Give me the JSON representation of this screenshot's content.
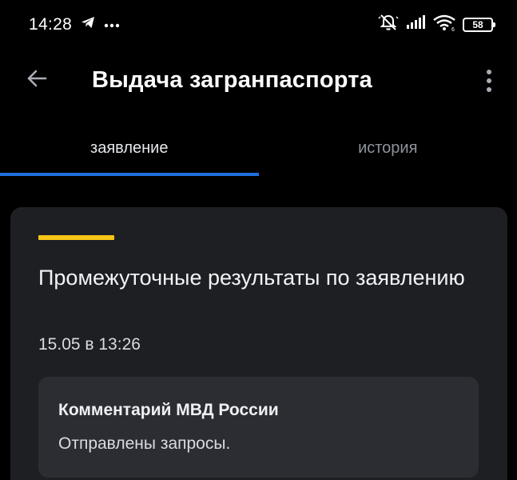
{
  "status_bar": {
    "time": "14:28",
    "left_icons": [
      "telegram-icon",
      "more-notifications-icon"
    ],
    "right_icons": [
      "alarm-off-icon",
      "signal-icon",
      "wifi-icon"
    ],
    "battery": "58"
  },
  "app_bar": {
    "title": "Выдача загранпаспорта",
    "back_icon": "arrow-left-icon",
    "menu_icon": "more-vertical-icon"
  },
  "tabs": [
    {
      "label": "заявление",
      "active": true
    },
    {
      "label": "история",
      "active": false
    }
  ],
  "card": {
    "accent_color": "#f5c518",
    "title": "Промежуточные результаты по заявлению",
    "date": "15.05 в 13:26",
    "comment": {
      "author": "Комментарий МВД России",
      "text": "Отправлены запросы."
    }
  },
  "colors": {
    "background": "#000000",
    "card": "#1e1f23",
    "comment_box": "#2c2d32",
    "tab_indicator": "#1f6fe0"
  }
}
